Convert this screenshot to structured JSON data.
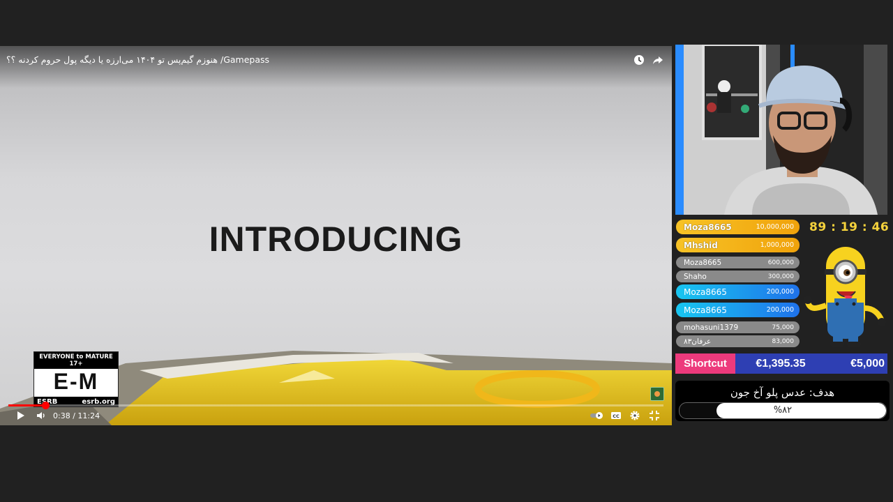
{
  "player": {
    "title": "هنوزم گیم‌پس تو ۱۴۰۴ می‌ارزه یا دیگه پول حروم کردنه ؟؟ /Gamepass",
    "overlay_text": "INTRODUCING",
    "esrb": {
      "top": "EVERYONE to MATURE 17+",
      "rating": "E-M",
      "brand": "ESRB",
      "site": "esrb.org"
    },
    "time": "0:38 / 11:24",
    "progress": 0.056
  },
  "donations": [
    {
      "name": "Moza8665",
      "amount": "10,000,000",
      "style": "gold"
    },
    {
      "name": "Mhshid",
      "amount": "1,000,000",
      "style": "gold"
    },
    {
      "name": "Moza8665",
      "amount": "600,000",
      "style": "gray"
    },
    {
      "name": "Shaho",
      "amount": "300,000",
      "style": "gray"
    },
    {
      "name": "Moza8665",
      "amount": "200,000",
      "style": "blue"
    },
    {
      "name": "Moza8665",
      "amount": "200,000",
      "style": "blue"
    },
    {
      "name": "mohasuni1379",
      "amount": "75,000",
      "style": "gray"
    },
    {
      "name": "عرفان۸۳",
      "amount": "83,000",
      "style": "gray"
    }
  ],
  "timer": "89 : 19 : 46",
  "shortcut": {
    "label": "Shortcut",
    "raised": "€1,395.35",
    "goal": "€5,000"
  },
  "goal": {
    "title": "هدف: عدس پلو آخ جون",
    "percent_text": "%۸۲",
    "percent": 0.82
  },
  "colors": {
    "accent_pink": "#ed3a7c",
    "bar_blue": "#2e3fb3",
    "timer_yellow": "#f5d23c",
    "progress_red": "#ff0000"
  }
}
